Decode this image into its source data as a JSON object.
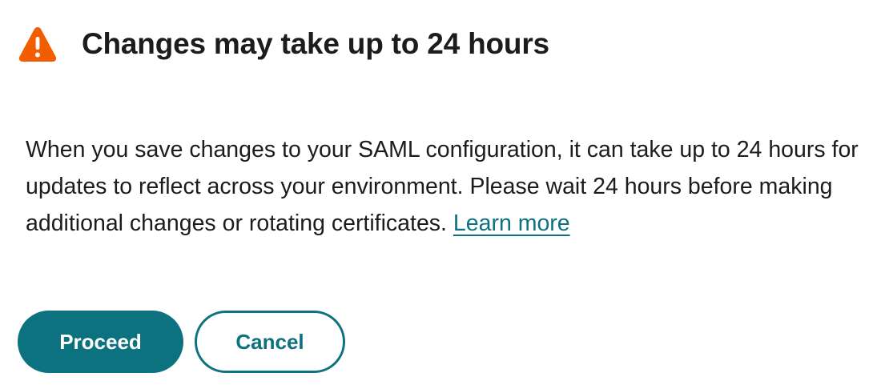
{
  "dialog": {
    "title": "Changes may take up to 24 hours",
    "icon": "warning-triangle-icon",
    "icon_color": "#f25d00",
    "body": "When you save changes to your SAML configuration, it can take up to 24 hours for updates to reflect across your environment. Please wait 24 hours before making additional changes or rotating certificates.",
    "learn_more_label": "Learn more",
    "proceed_label": "Proceed",
    "cancel_label": "Cancel"
  },
  "colors": {
    "accent": "#0d7280",
    "text": "#1c1c1c",
    "warning": "#f25d00"
  }
}
